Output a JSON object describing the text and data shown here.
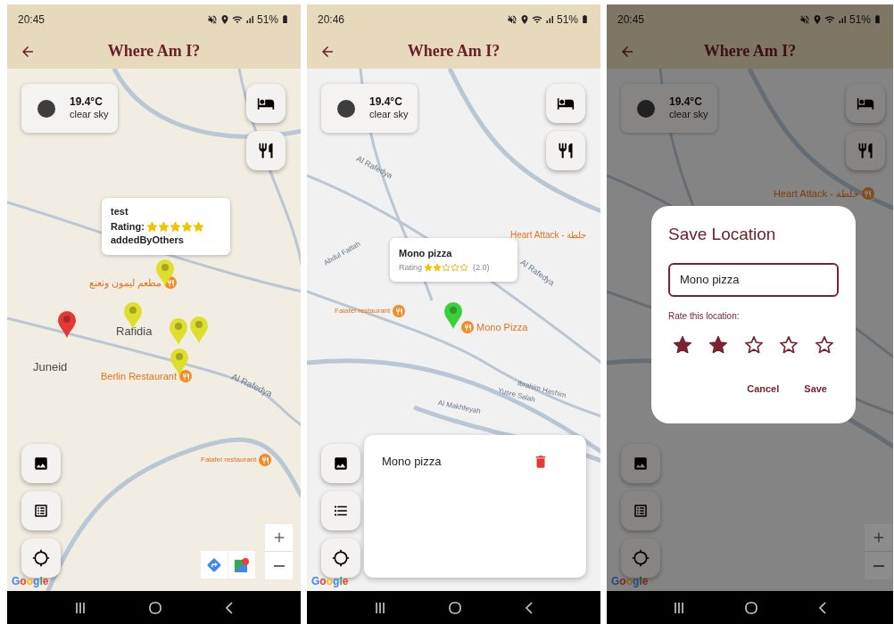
{
  "screens": [
    {
      "status_bar": {
        "time": "20:45",
        "battery": "51%"
      },
      "app_bar": {
        "title": "Where Am I?"
      },
      "weather": {
        "temperature": "19.4°C",
        "description": "clear sky"
      },
      "map_labels": [
        {
          "kind": "place",
          "text": "Rafidia"
        },
        {
          "kind": "place",
          "text": "Juneid"
        },
        {
          "kind": "restaurant",
          "text": "مطعم ليمون ونعنع"
        },
        {
          "kind": "restaurant",
          "text": "Berlin Restaurant"
        },
        {
          "kind": "street",
          "text": "Al Rafedya"
        },
        {
          "kind": "restaurant",
          "text": "Falafel restaurant"
        }
      ],
      "pins": [
        {
          "color": "#e53935"
        },
        {
          "color": "#dede2c"
        },
        {
          "color": "#dede2c"
        },
        {
          "color": "#dede2c"
        },
        {
          "color": "#dede2c"
        },
        {
          "color": "#dede2c"
        }
      ],
      "info_window": {
        "title": "test",
        "rating_label": "Rating:",
        "stars": 5,
        "note": "addedByOthers"
      },
      "map_logo": "Google"
    },
    {
      "status_bar": {
        "time": "20:46",
        "battery": "51%"
      },
      "app_bar": {
        "title": "Where Am I?"
      },
      "weather": {
        "temperature": "19.4°C",
        "description": "clear sky"
      },
      "map_labels": [
        {
          "kind": "street",
          "text": "Al Rafedya"
        },
        {
          "kind": "restaurant",
          "text": "Heart Attack - جلطة"
        },
        {
          "kind": "street",
          "text": "Al Rafedya"
        },
        {
          "kind": "street",
          "text": "Abdul Fattah"
        },
        {
          "kind": "restaurant",
          "text": "Falafel restaurant"
        },
        {
          "kind": "restaurant",
          "text": "Mono Pizza"
        },
        {
          "kind": "street",
          "text": "Ibrahim Hashim"
        },
        {
          "kind": "street",
          "text": "Yusre Salah"
        },
        {
          "kind": "street",
          "text": "Al Makhfeyah"
        }
      ],
      "pins": [
        {
          "color": "#3ccf3c"
        }
      ],
      "info_window": {
        "title": "Mono pizza",
        "rating_label": "Rating",
        "stars": 2,
        "score": "(2.0)"
      },
      "saved_list": [
        {
          "name": "Mono pizza"
        }
      ],
      "map_logo": "Google"
    },
    {
      "status_bar": {
        "time": "20:45",
        "battery": "51%"
      },
      "app_bar": {
        "title": "Where Am I?"
      },
      "weather": {
        "temperature": "19.4°C",
        "description": "clear sky"
      },
      "map_labels": [
        {
          "kind": "restaurant",
          "text": "Heart Attack - جلطة"
        }
      ],
      "dialog": {
        "title": "Save Location",
        "input_value": "Mono pizza",
        "rating_label": "Rate this location:",
        "stars": 2,
        "buttons": [
          "Cancel",
          "Save"
        ]
      },
      "map_logo": "Google"
    }
  ]
}
